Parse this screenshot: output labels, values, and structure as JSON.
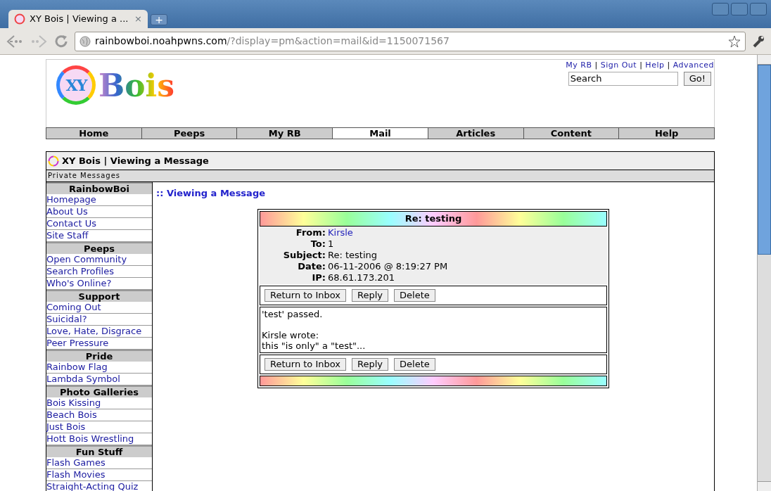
{
  "browser": {
    "tab": {
      "title": "XY Bois | Viewing a ...",
      "close": "×"
    },
    "new_tab": "+",
    "url": {
      "host": "rainbowboi.noahpwns.com",
      "path": "/?display=pm&action=mail&id=1150071567"
    }
  },
  "header": {
    "logo": {
      "mark": "XY",
      "word": "Bois"
    },
    "top_links": [
      "My RB",
      "Sign Out",
      "Help",
      "Advanced"
    ],
    "separator": "|",
    "search": {
      "value": "Search"
    },
    "go_button": "Go!"
  },
  "nav": [
    {
      "label": "Home",
      "selected": false
    },
    {
      "label": "Peeps",
      "selected": false
    },
    {
      "label": "My RB",
      "selected": false
    },
    {
      "label": "Mail",
      "selected": true
    },
    {
      "label": "Articles",
      "selected": false
    },
    {
      "label": "Content",
      "selected": false
    },
    {
      "label": "Help",
      "selected": false
    }
  ],
  "page_title": "XY Bois | Viewing a Message",
  "breadcrumb": "Private Messages",
  "sidebar": [
    {
      "heading": "RainbowBoi",
      "items": [
        "Homepage",
        "About Us",
        "Contact Us",
        "Site Staff"
      ]
    },
    {
      "heading": "Peeps",
      "items": [
        "Open Community",
        "Search Profiles",
        "Who's Online?"
      ]
    },
    {
      "heading": "Support",
      "items": [
        "Coming Out",
        "Suicidal?",
        "Love, Hate, Disgrace",
        "Peer Pressure"
      ]
    },
    {
      "heading": "Pride",
      "items": [
        "Rainbow Flag",
        "Lambda Symbol"
      ]
    },
    {
      "heading": "Photo Galleries",
      "items": [
        "Bois Kissing",
        "Beach Bois",
        "Just Bois",
        "Hott Bois Wrestling"
      ]
    },
    {
      "heading": "Fun Stuff",
      "items": [
        "Flash Games",
        "Flash Movies",
        "Straight-Acting Quiz"
      ]
    }
  ],
  "section_title": ":: Viewing a Message",
  "message": {
    "subject_bar": "Re: testing",
    "fields": [
      {
        "label": "From:",
        "value": "Kirsle",
        "kind": "link"
      },
      {
        "label": "To:",
        "value": "1",
        "kind": "text"
      },
      {
        "label": "Subject:",
        "value": "Re: testing",
        "kind": "text"
      },
      {
        "label": "Date:",
        "value": "06-11-2006 @ 8:19:27 PM",
        "kind": "text"
      },
      {
        "label": "IP:",
        "value": "68.61.173.201",
        "kind": "text"
      }
    ],
    "buttons_top": [
      "Return to Inbox",
      "Reply",
      "Delete"
    ],
    "body": [
      "'test' passed.",
      "Kirsle wrote:\nthis \"is only\" a \"test\"..."
    ],
    "buttons_bottom": [
      "Return to Inbox",
      "Reply",
      "Delete"
    ]
  }
}
